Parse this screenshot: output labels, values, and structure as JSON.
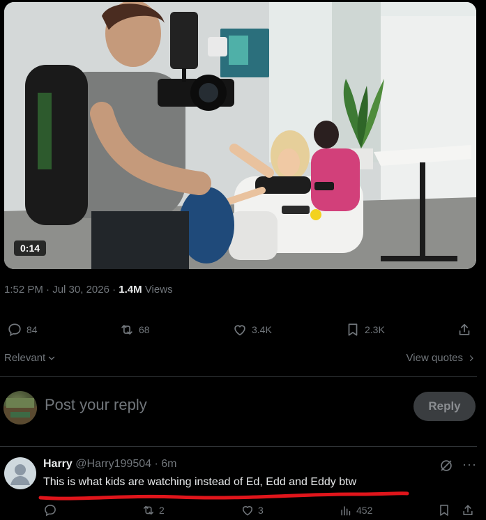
{
  "video": {
    "duration": "0:14"
  },
  "meta": {
    "time": "1:52 PM",
    "sep1": " · ",
    "date": "Jul 30, 2026",
    "sep2": " · ",
    "views_count": "1.4M",
    "views_label": " Views"
  },
  "actions": {
    "replies": "84",
    "reposts": "68",
    "likes": "3.4K",
    "bookmarks": "2.3K"
  },
  "sort": {
    "label": "Relevant",
    "quotes_link": "View quotes"
  },
  "composer": {
    "placeholder": "Post your reply",
    "button": "Reply"
  },
  "reply": {
    "name": "Harry",
    "handle": "@Harry199504",
    "sep": " · ",
    "time": "6m",
    "text": "This is what kids are watching instead of Ed, Edd and Eddy btw",
    "reposts": "2",
    "likes": "3",
    "views": "452"
  },
  "colors": {
    "background": "#000000",
    "text_primary": "#e7e9ea",
    "text_secondary": "#71767b",
    "divider": "#2f3336",
    "underline": "#e0151b"
  }
}
